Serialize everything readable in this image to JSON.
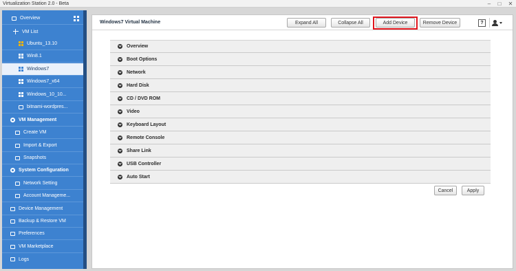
{
  "window": {
    "title": "Virtualization Station 2.0 - Beta",
    "controls": [
      "minimize",
      "maximize",
      "close"
    ]
  },
  "sidebar": {
    "items": [
      {
        "label": "Overview",
        "icon": "box-icon",
        "bold": false
      },
      {
        "label": "VM List",
        "icon": "plus-icon",
        "bold": false
      },
      {
        "label": "Ubuntu_13.10",
        "icon": "ubuntu-icon",
        "bold": false
      },
      {
        "label": "Win8.1",
        "icon": "windows-icon",
        "bold": false
      },
      {
        "label": "Windows7",
        "icon": "windows-icon",
        "bold": false,
        "active": true
      },
      {
        "label": "Windows7_x64",
        "icon": "windows-icon",
        "bold": false
      },
      {
        "label": "Windows_10_10...",
        "icon": "windows-icon",
        "bold": false
      },
      {
        "label": "bitnami-wordpres...",
        "icon": "box-icon",
        "bold": false
      },
      {
        "label": "VM Management",
        "icon": "gear-icon",
        "bold": true
      },
      {
        "label": "Create VM",
        "icon": "create-icon",
        "bold": false
      },
      {
        "label": "Import & Export",
        "icon": "import-export-icon",
        "bold": false
      },
      {
        "label": "Snapshots",
        "icon": "snapshot-icon",
        "bold": false
      },
      {
        "label": "System Configuration",
        "icon": "gear-icon",
        "bold": true
      },
      {
        "label": "Network Setting",
        "icon": "network-icon",
        "bold": false
      },
      {
        "label": "Account Manageme...",
        "icon": "account-icon",
        "bold": false
      },
      {
        "label": "Device Management",
        "icon": "device-icon",
        "bold": false
      },
      {
        "label": "Backup & Restore VM",
        "icon": "backup-icon",
        "bold": false
      },
      {
        "label": "Preferences",
        "icon": "preferences-icon",
        "bold": false
      },
      {
        "label": "VM Marketplace",
        "icon": "marketplace-icon",
        "bold": false
      },
      {
        "label": "Logs",
        "icon": "logs-icon",
        "bold": false
      }
    ]
  },
  "header": {
    "vm_name": "Windows7 Virtual Machine",
    "expand_all": "Expand All",
    "collapse_all": "Collapse All",
    "add_device": "Add Device",
    "remove_device": "Remove Device",
    "help": "?"
  },
  "sections": [
    "Overview",
    "Boot Options",
    "Network",
    "Hard Disk",
    "CD / DVD ROM",
    "Video",
    "Keyboard Layout",
    "Remote Console",
    "Share Link",
    "USB Controller",
    "Auto Start"
  ],
  "footer": {
    "cancel": "Cancel",
    "apply": "Apply"
  },
  "colors": {
    "sidebar_bg": "#3d82d0",
    "highlight_border": "#e0141c",
    "active_item_bg": "#eaf1fb"
  }
}
